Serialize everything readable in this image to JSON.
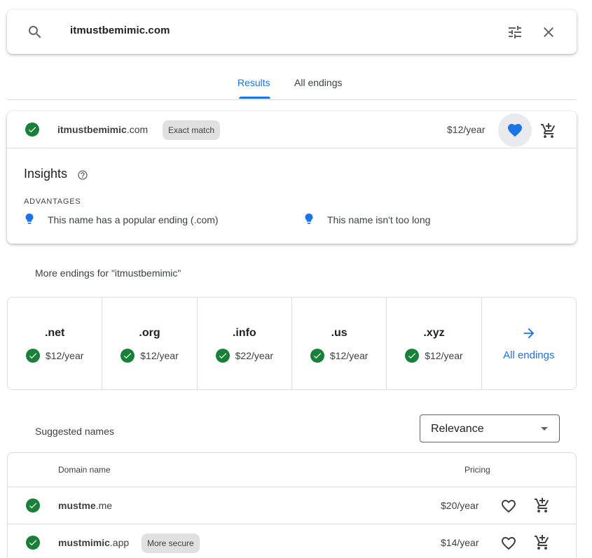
{
  "search": {
    "query": "itmustbemimic.com"
  },
  "tabs": [
    {
      "label": "Results",
      "active": true
    },
    {
      "label": "All endings",
      "active": false
    }
  ],
  "result": {
    "sld": "itmustbemimic",
    "tld": ".com",
    "badge": "Exact match",
    "price": "$12/year",
    "favorited": true
  },
  "insights": {
    "title": "Insights",
    "advantages_label": "ADVANTAGES",
    "advantages": [
      "This name has a popular ending (.com)",
      "This name isn't too long"
    ]
  },
  "more_endings": {
    "title": "More endings for \"itmustbemimic\"",
    "items": [
      {
        "ext": ".net",
        "price": "$12/year"
      },
      {
        "ext": ".org",
        "price": "$12/year"
      },
      {
        "ext": ".info",
        "price": "$22/year"
      },
      {
        "ext": ".us",
        "price": "$12/year"
      },
      {
        "ext": ".xyz",
        "price": "$12/year"
      }
    ],
    "all_label": "All endings"
  },
  "suggested": {
    "title": "Suggested names",
    "sort": {
      "value": "Relevance"
    },
    "columns": {
      "domain": "Domain name",
      "pricing": "Pricing"
    },
    "rows": [
      {
        "sld": "mustme",
        "tld": ".me",
        "badge": "",
        "price": "$20/year"
      },
      {
        "sld": "mustmimic",
        "tld": ".app",
        "badge": "More secure",
        "price": "$14/year"
      }
    ]
  },
  "colors": {
    "accent": "#1a73e8",
    "available": "#188038",
    "chip": "#e0e0e0"
  }
}
